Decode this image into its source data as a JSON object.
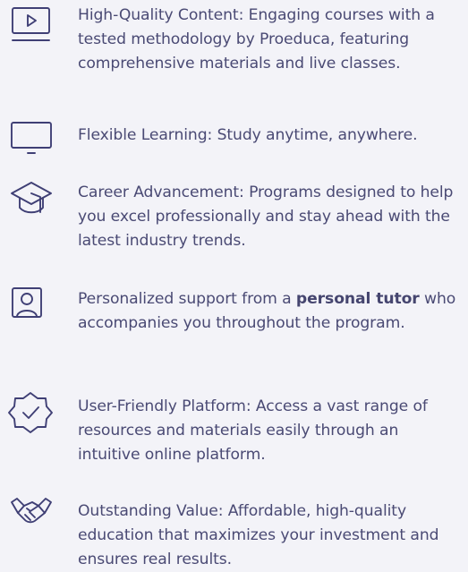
{
  "features": [
    {
      "icon": "play-video-icon",
      "text": "High-Quality Content: Engaging courses with a tested methodology by Proeduca, featuring comprehensive materials and live classes."
    },
    {
      "icon": "monitor-icon",
      "text": "Flexible Learning: Study anytime, anywhere."
    },
    {
      "icon": "graduation-cap-icon",
      "text": "Career Advancement: Programs designed to help you excel professionally and stay ahead with the latest industry trends."
    },
    {
      "icon": "user-profile-icon",
      "text_before": "Personalized support from a ",
      "text_bold": "personal tutor",
      "text_after": " who accompanies you throughout the program."
    },
    {
      "icon": "verified-badge-icon",
      "text": "User-Friendly Platform: Access a vast range of resources and materials easily through an intuitive online platform."
    },
    {
      "icon": "handshake-icon",
      "text": "Outstanding Value: Affordable, high-quality education that maximizes your investment and ensures real results."
    }
  ]
}
